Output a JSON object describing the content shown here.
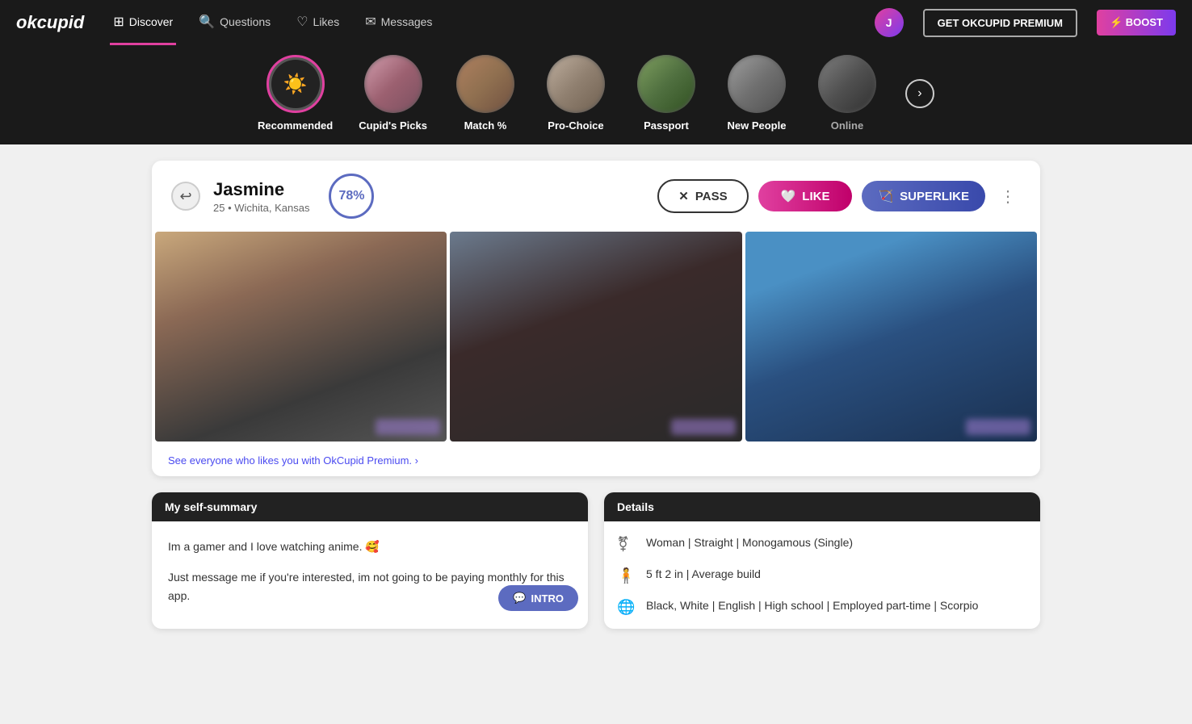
{
  "logo": "okcupid",
  "nav": {
    "items": [
      {
        "id": "discover",
        "label": "Discover",
        "icon": "⊞",
        "active": true
      },
      {
        "id": "questions",
        "label": "Questions",
        "icon": "?"
      },
      {
        "id": "likes",
        "label": "Likes",
        "icon": "♡"
      },
      {
        "id": "messages",
        "label": "Messages",
        "icon": "✉"
      }
    ],
    "premium_label": "GET OKCUPID PREMIUM",
    "boost_label": "⚡ BOOST"
  },
  "categories": [
    {
      "id": "recommended",
      "label": "Recommended",
      "active": true,
      "icon_type": "symbol"
    },
    {
      "id": "cupids-picks",
      "label": "Cupid's Picks",
      "active": false
    },
    {
      "id": "match",
      "label": "Match %",
      "active": false
    },
    {
      "id": "pro-choice",
      "label": "Pro-Choice",
      "active": false
    },
    {
      "id": "passport",
      "label": "Passport",
      "active": false
    },
    {
      "id": "new-people",
      "label": "New People",
      "active": false
    },
    {
      "id": "online",
      "label": "Online",
      "active": false,
      "dim": true
    }
  ],
  "profile": {
    "name": "Jasmine",
    "age": "25",
    "location": "Wichita, Kansas",
    "match_percent": "78%",
    "pass_label": "PASS",
    "like_label": "LIKE",
    "superlike_label": "SUPERLIKE",
    "premium_prompt": "See everyone who likes you with OkCupid Premium. ›",
    "self_summary": {
      "header": "My self-summary",
      "text1": "Im a gamer and I love watching anime. 🥰",
      "text2": "Just message me if you're interested, im not going to be paying monthly for this app.",
      "intro_label": "INTRO",
      "intro_icon": "💬"
    },
    "details": {
      "header": "Details",
      "items": [
        {
          "icon": "gender",
          "text": "Woman | Straight | Monogamous (Single)"
        },
        {
          "icon": "height",
          "text": "5 ft 2 in | Average build"
        },
        {
          "icon": "globe",
          "text": "Black, White | English | High school | Employed part-time | Scorpio"
        }
      ]
    }
  }
}
